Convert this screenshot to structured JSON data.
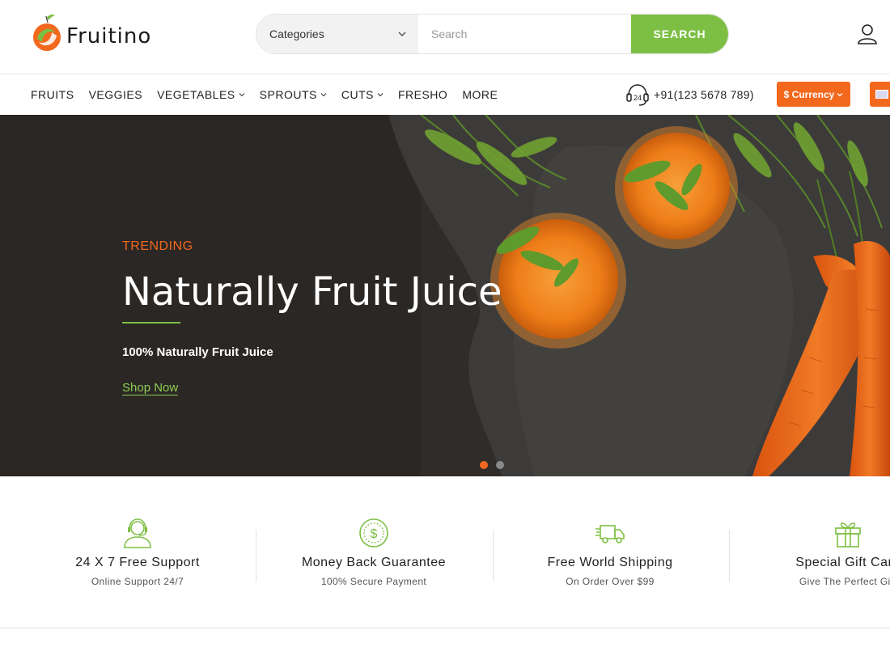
{
  "brand": {
    "name": "Fruitino"
  },
  "search": {
    "category_label": "Categories",
    "placeholder": "Search",
    "value": "",
    "button_label": "SEARCH"
  },
  "nav": {
    "items": [
      {
        "label": "FRUITS",
        "has_dropdown": false
      },
      {
        "label": "VEGGIES",
        "has_dropdown": false
      },
      {
        "label": "VEGETABLES",
        "has_dropdown": true
      },
      {
        "label": "SPROUTS",
        "has_dropdown": true
      },
      {
        "label": "CUTS",
        "has_dropdown": true
      },
      {
        "label": "FRESHO",
        "has_dropdown": false
      },
      {
        "label": "MORE",
        "has_dropdown": false
      }
    ],
    "phone": "+91(123 5678 789)",
    "support_badge": "24",
    "currency_label": "$ Currency"
  },
  "hero": {
    "tag": "TRENDING",
    "title": "Naturally Fruit Juice",
    "subtitle": "100% Naturally Fruit Juice",
    "cta": "Shop Now",
    "slides": 2,
    "active_slide": 1
  },
  "features": [
    {
      "icon": "support-agent-icon",
      "title": "24 X 7 Free Support",
      "subtitle": "Online Support 24/7"
    },
    {
      "icon": "dollar-coin-icon",
      "title": "Money Back Guarantee",
      "subtitle": "100% Secure Payment"
    },
    {
      "icon": "delivery-truck-icon",
      "title": "Free World Shipping",
      "subtitle": "On Order Over $99"
    },
    {
      "icon": "gift-icon",
      "title": "Special Gift Card",
      "subtitle": "Give The Perfect Gift"
    }
  ],
  "colors": {
    "accent_green": "#7dbf44",
    "accent_orange": "#f2681d",
    "hero_bg": "#2e2b28"
  }
}
